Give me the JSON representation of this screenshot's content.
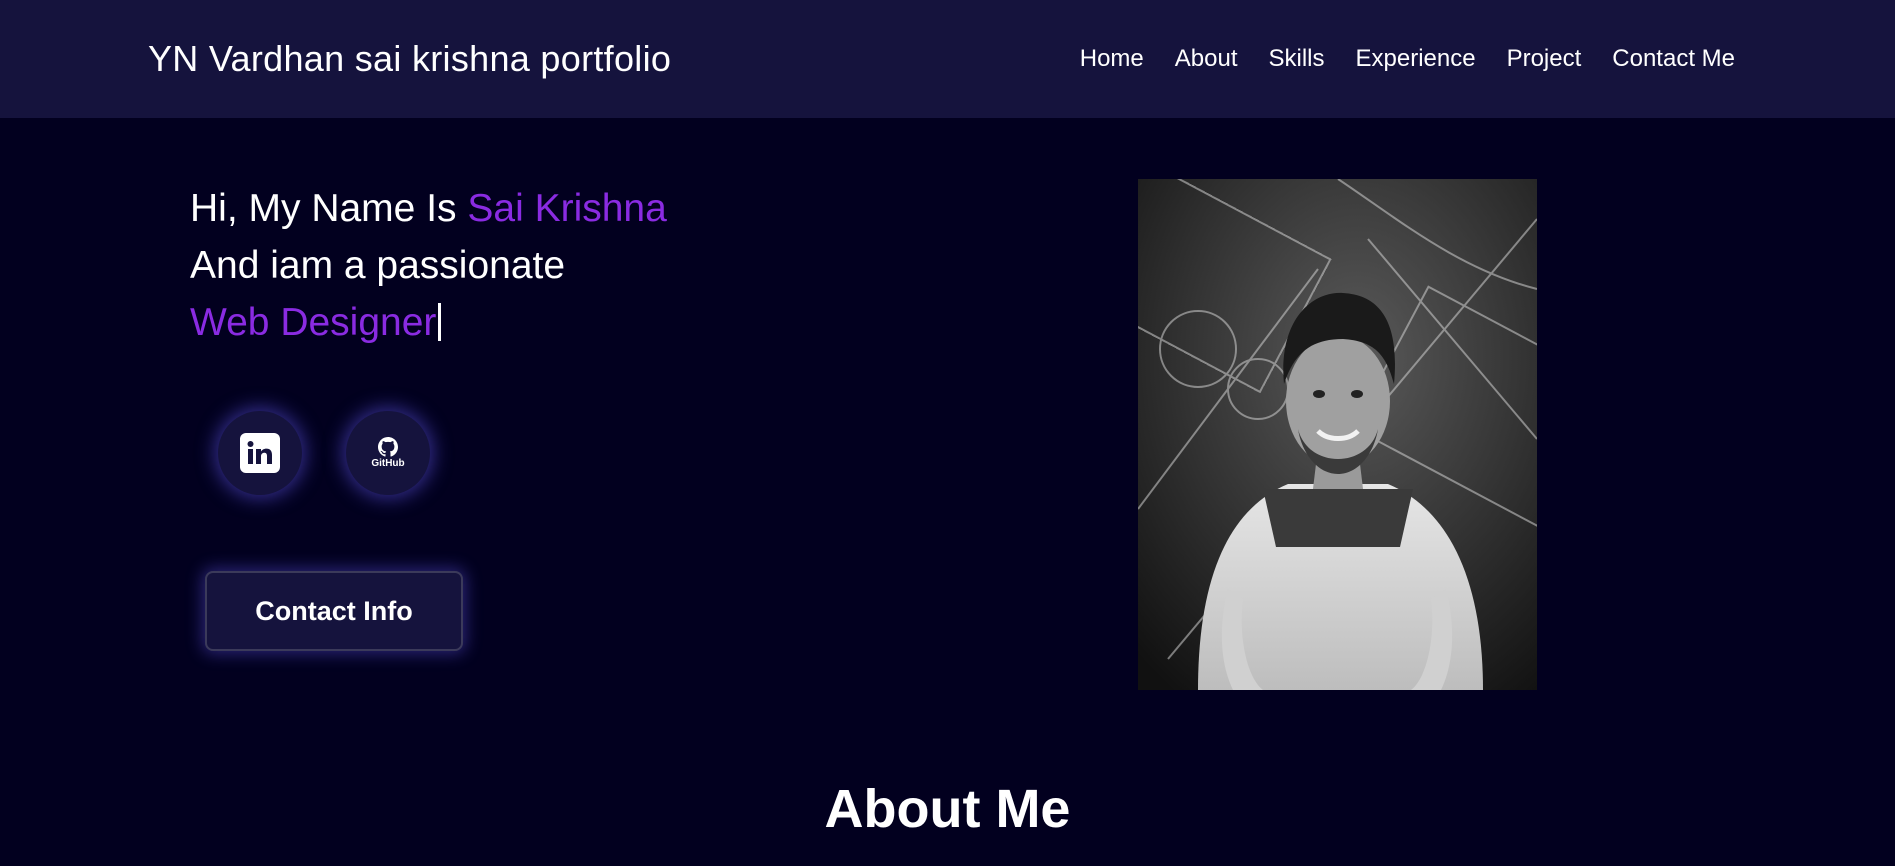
{
  "header": {
    "brand": "YN Vardhan sai krishna portfolio",
    "nav": [
      "Home",
      "About",
      "Skills",
      "Experience",
      "Project",
      "Contact Me"
    ]
  },
  "hero": {
    "line1_prefix": "Hi, My Name Is ",
    "line1_name": "Sai Krishna",
    "line2": "And iam a passionate",
    "line3_role": "Web Designer"
  },
  "social": {
    "linkedin_icon": "linkedin-icon",
    "github_icon": "github-icon",
    "github_label": "GitHub"
  },
  "contact_button": "Contact Info",
  "about": {
    "title": "About Me"
  },
  "colors": {
    "background": "#02001f",
    "navbar": "#15133d",
    "accent": "#8a2be2",
    "text": "#ffffff"
  }
}
